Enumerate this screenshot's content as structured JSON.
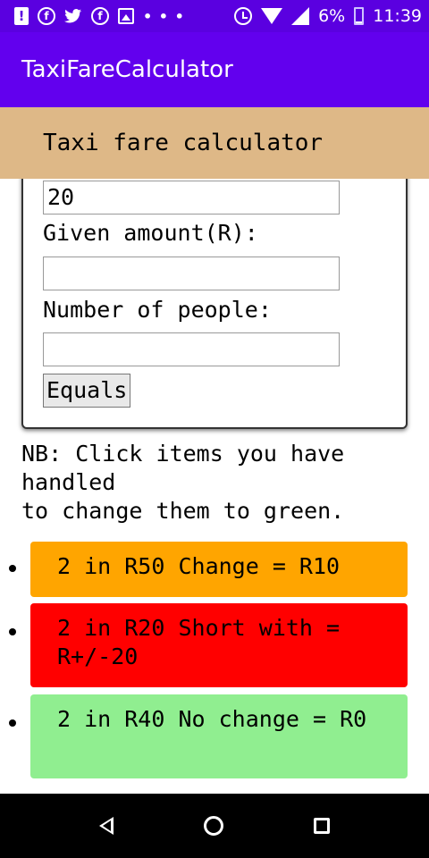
{
  "status_bar": {
    "icons": [
      "alert-icon",
      "facebook-icon",
      "twitter-icon",
      "facebook-icon",
      "image-icon",
      "more-dots-icon",
      "alarm-icon",
      "wifi-icon",
      "signal-icon",
      "battery-icon"
    ],
    "alert_glyph": "!",
    "fb_glyph": "f",
    "dots": "• • •",
    "battery": "6%",
    "time": "11:39"
  },
  "app_bar": {
    "title": "TaxiFareCalculator"
  },
  "header": {
    "title": "Taxi fare calculator"
  },
  "form": {
    "fare_value": "20",
    "given_amount_label": "Given amount(R):",
    "given_amount_value": "",
    "people_label": "Number of people:",
    "people_value": "",
    "equals_label": "Equals"
  },
  "note": "NB: Click items you have handled\nto change them to green.",
  "items": [
    {
      "text": "2 in R50 Change = R10",
      "color": "#ffa500"
    },
    {
      "text": "2 in R20 Short with = R+/-20",
      "color": "#ff0000"
    },
    {
      "text": "2 in R40 No change = R0",
      "color": "#90ee90"
    }
  ],
  "nav": {
    "icons": [
      "back-icon",
      "home-icon",
      "recents-icon"
    ]
  }
}
